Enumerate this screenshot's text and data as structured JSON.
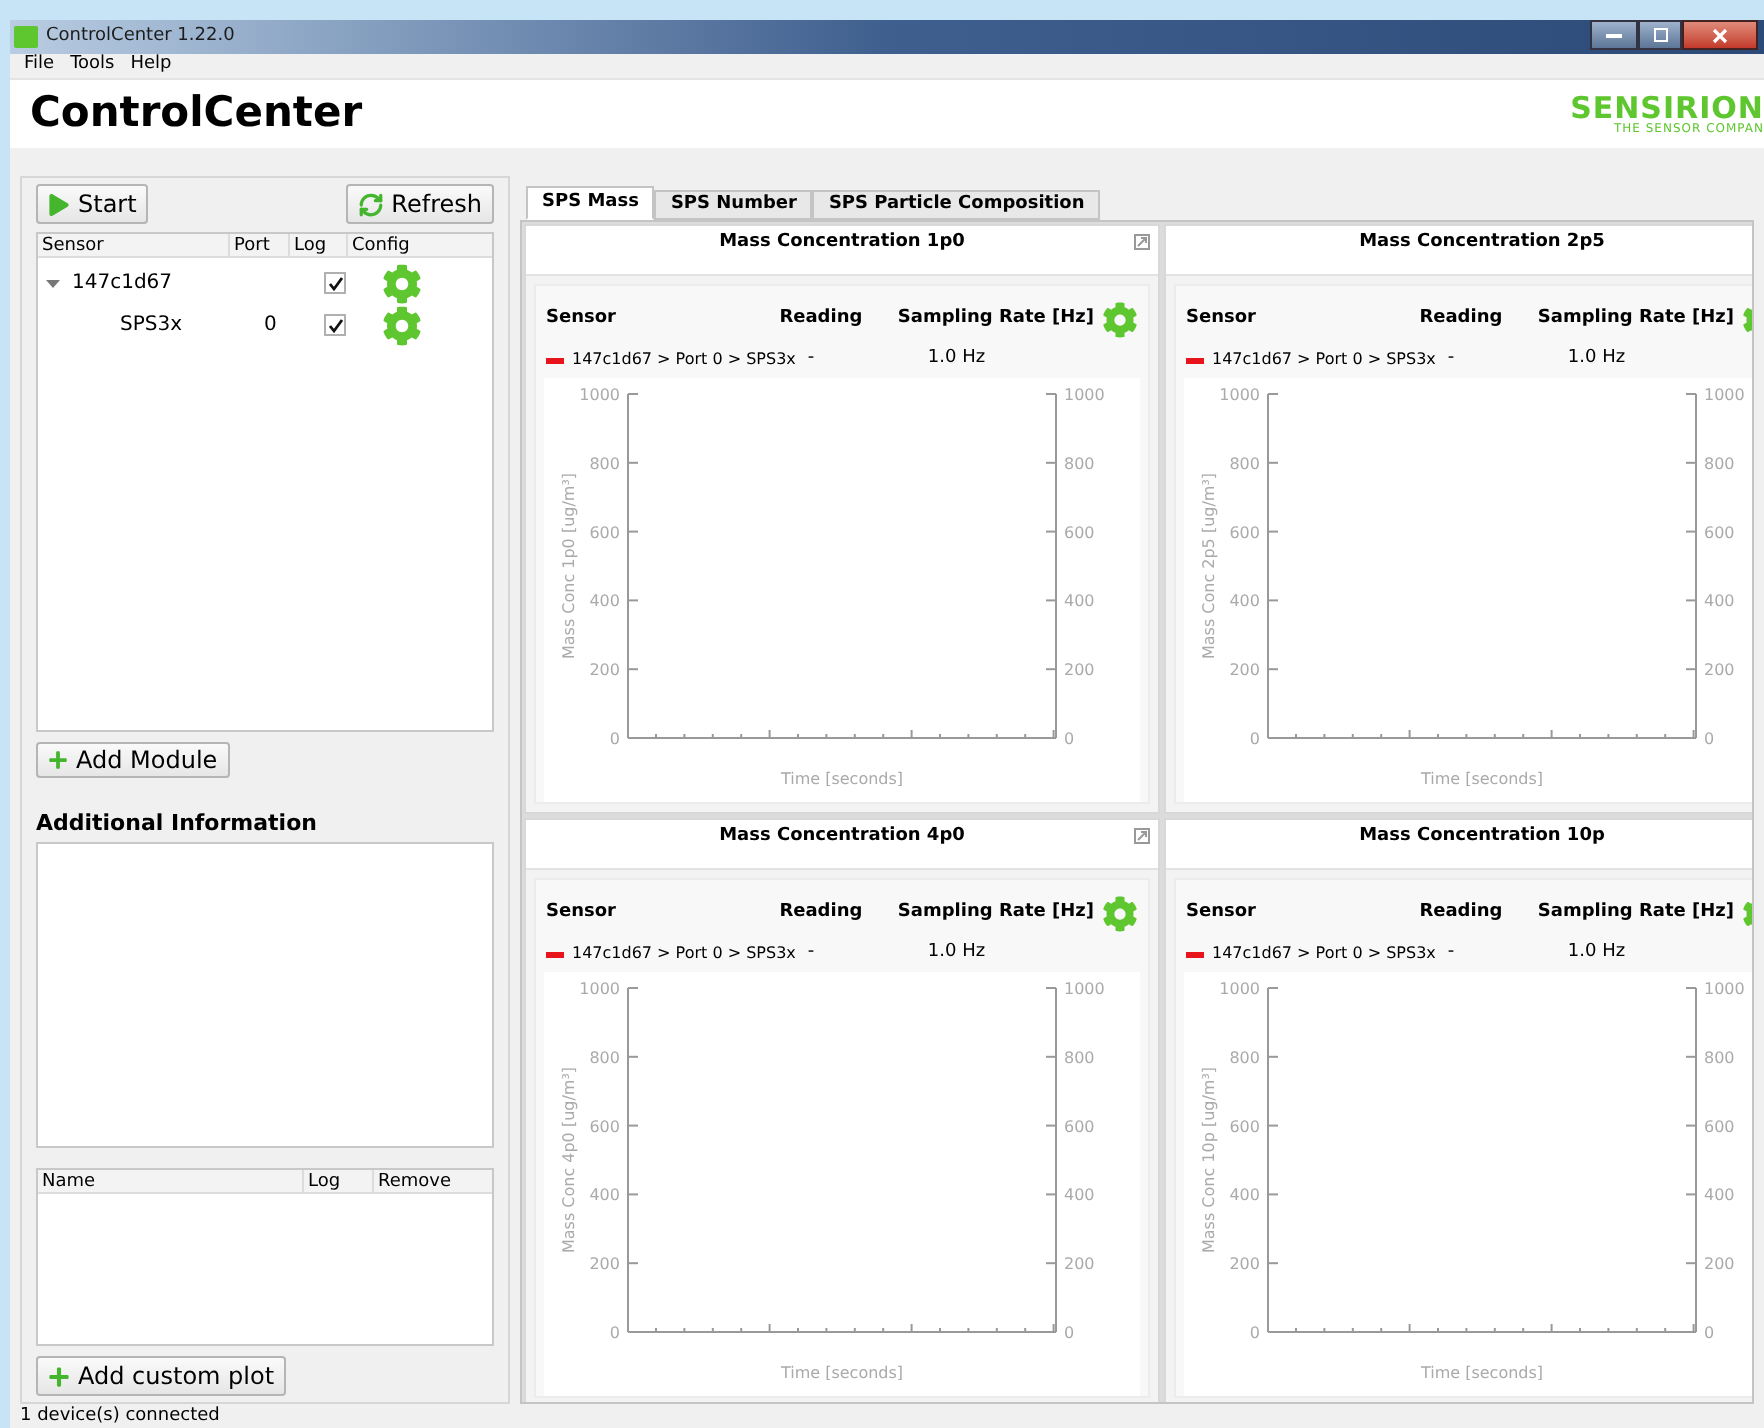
{
  "window": {
    "title": "ControlCenter 1.22.0"
  },
  "menu": [
    "File",
    "Tools",
    "Help"
  ],
  "header": {
    "title": "ControlCenter",
    "logo": "SENSIRION",
    "tagline": "THE SENSOR COMPAN"
  },
  "left": {
    "start_button": "Start",
    "refresh_button": "Refresh",
    "sensor_columns": [
      "Sensor",
      "Port",
      "Log",
      "Config"
    ],
    "sensor_tree": [
      {
        "sensor": "147c1d67",
        "log": true,
        "expanded": true,
        "children": [
          {
            "sensor": "SPS3x",
            "port": "0",
            "log": true
          }
        ]
      }
    ],
    "add_module_button": "Add Module",
    "additional_title": "Additional Information",
    "custom_columns": [
      "Name",
      "Log",
      "Remove"
    ],
    "add_custom_plot_button": "Add custom plot"
  },
  "tabs": [
    {
      "label": "SPS Mass",
      "selected": true
    },
    {
      "label": "SPS Number",
      "selected": false
    },
    {
      "label": "SPS Particle Composition",
      "selected": false
    }
  ],
  "plots": [
    {
      "title": "Mass Concentration 1p0",
      "detachable": true,
      "columns": [
        "Sensor",
        "Reading",
        "Sampling Rate [Hz]"
      ],
      "rows": [
        {
          "sensor": "147c1d67 > Port 0 > SPS3x",
          "reading": "-",
          "rate": "1.0 Hz"
        }
      ],
      "chart_data": {
        "type": "line",
        "xlabel": "Time [seconds]",
        "ylabel": "Mass Conc 1p0 [ug/m³]",
        "categories": [
          null,
          null,
          null,
          null
        ],
        "series": [
          {
            "color": "#e8141c",
            "values": [
              null,
              null,
              null,
              null
            ]
          }
        ],
        "ylim": [
          0,
          1000
        ],
        "yticks": [
          0,
          200,
          400,
          600,
          800,
          1000
        ],
        "y2lim": [
          0,
          1000
        ],
        "y2ticks": [
          0,
          200,
          400,
          600,
          800,
          1000
        ]
      }
    },
    {
      "title": "Mass Concentration 2p5",
      "detachable": false,
      "columns": [
        "Sensor",
        "Reading",
        "Sampling Rate [Hz]"
      ],
      "rows": [
        {
          "sensor": "147c1d67 > Port 0 > SPS3x",
          "reading": "-",
          "rate": "1.0 Hz"
        }
      ],
      "chart_data": {
        "type": "line",
        "xlabel": "Time [seconds]",
        "ylabel": "Mass Conc 2p5 [ug/m³]",
        "categories": [
          null,
          null,
          null,
          null
        ],
        "series": [
          {
            "color": "#e8141c",
            "values": [
              null,
              null,
              null,
              null
            ]
          }
        ],
        "ylim": [
          0,
          1000
        ],
        "yticks": [
          0,
          200,
          400,
          600,
          800,
          1000
        ],
        "y2lim": [
          0,
          1000
        ],
        "y2ticks": [
          0,
          200,
          400,
          600,
          800,
          1000
        ]
      }
    },
    {
      "title": "Mass Concentration 4p0",
      "detachable": true,
      "columns": [
        "Sensor",
        "Reading",
        "Sampling Rate [Hz]"
      ],
      "rows": [
        {
          "sensor": "147c1d67 > Port 0 > SPS3x",
          "reading": "-",
          "rate": "1.0 Hz"
        }
      ],
      "chart_data": {
        "type": "line",
        "xlabel": "Time [seconds]",
        "ylabel": "Mass Conc 4p0 [ug/m³]",
        "categories": [
          null,
          null,
          null,
          null
        ],
        "series": [
          {
            "color": "#e8141c",
            "values": [
              null,
              null,
              null,
              null
            ]
          }
        ],
        "ylim": [
          0,
          1000
        ],
        "yticks": [
          0,
          200,
          400,
          600,
          800,
          1000
        ],
        "y2lim": [
          0,
          1000
        ],
        "y2ticks": [
          0,
          200,
          400,
          600,
          800,
          1000
        ]
      }
    },
    {
      "title": "Mass Concentration 10p",
      "detachable": false,
      "columns": [
        "Sensor",
        "Reading",
        "Sampling Rate [Hz]"
      ],
      "rows": [
        {
          "sensor": "147c1d67 > Port 0 > SPS3x",
          "reading": "-",
          "rate": "1.0 Hz"
        }
      ],
      "chart_data": {
        "type": "line",
        "xlabel": "Time [seconds]",
        "ylabel": "Mass Conc 10p [ug/m³]",
        "categories": [
          null,
          null,
          null,
          null
        ],
        "series": [
          {
            "color": "#e8141c",
            "values": [
              null,
              null,
              null,
              null
            ]
          }
        ],
        "ylim": [
          0,
          1000
        ],
        "yticks": [
          0,
          200,
          400,
          600,
          800,
          1000
        ],
        "y2lim": [
          0,
          1000
        ],
        "y2ticks": [
          0,
          200,
          400,
          600,
          800,
          1000
        ]
      }
    }
  ],
  "status_bar": "1 device(s) connected"
}
